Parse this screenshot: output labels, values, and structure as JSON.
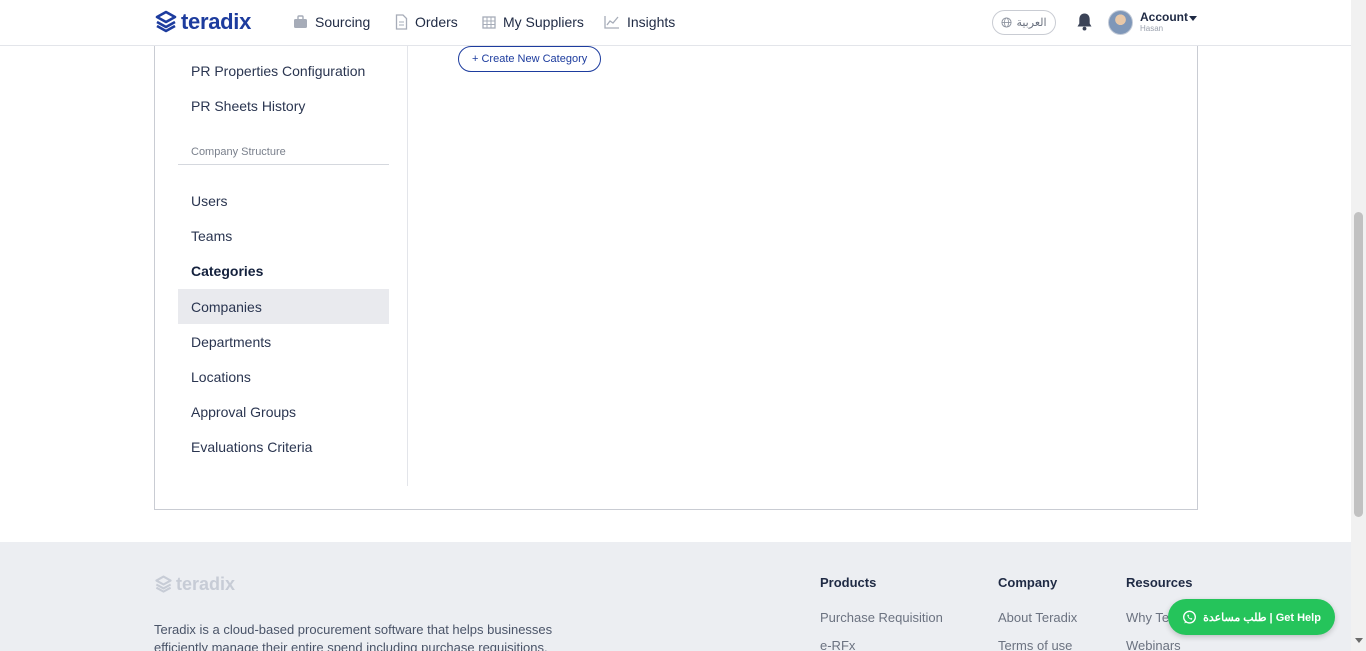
{
  "brand": {
    "name": "teradix",
    "color": "#1d3c9e"
  },
  "nav": {
    "items": [
      {
        "label": "Sourcing",
        "icon": "briefcase-icon"
      },
      {
        "label": "Orders",
        "icon": "document-icon"
      },
      {
        "label": "My Suppliers",
        "icon": "building-icon"
      },
      {
        "label": "Insights",
        "icon": "line-chart-icon"
      }
    ],
    "language": "العربية",
    "account_label": "Account",
    "account_user": "Hasan"
  },
  "sidebar": {
    "items_top": [
      {
        "label": "PR Properties Configuration"
      },
      {
        "label": "PR Sheets History"
      }
    ],
    "section_title": "Company Structure",
    "items": [
      {
        "label": "Users"
      },
      {
        "label": "Teams"
      },
      {
        "label": "Categories"
      },
      {
        "label": "Companies"
      },
      {
        "label": "Departments"
      },
      {
        "label": "Locations"
      },
      {
        "label": "Approval Groups"
      },
      {
        "label": "Evaluations Criteria"
      }
    ],
    "active_item": "Categories",
    "hovered_item": "Companies"
  },
  "main": {
    "create_button": "+ Create New Category"
  },
  "footer": {
    "logo": "teradix",
    "description": "Teradix is a cloud-based procurement software that helps businesses efficiently manage their entire spend including purchase requisitions,",
    "columns": [
      {
        "heading": "Products",
        "links": [
          "Purchase Requisition",
          "e-RFx"
        ]
      },
      {
        "heading": "Company",
        "links": [
          "About Teradix",
          "Terms of use"
        ]
      },
      {
        "heading": "Resources",
        "links": [
          "Why Teradix",
          "Webinars"
        ]
      }
    ]
  },
  "help_button": {
    "label": "طلب مساعدة | Get Help",
    "color": "#25c45b"
  }
}
